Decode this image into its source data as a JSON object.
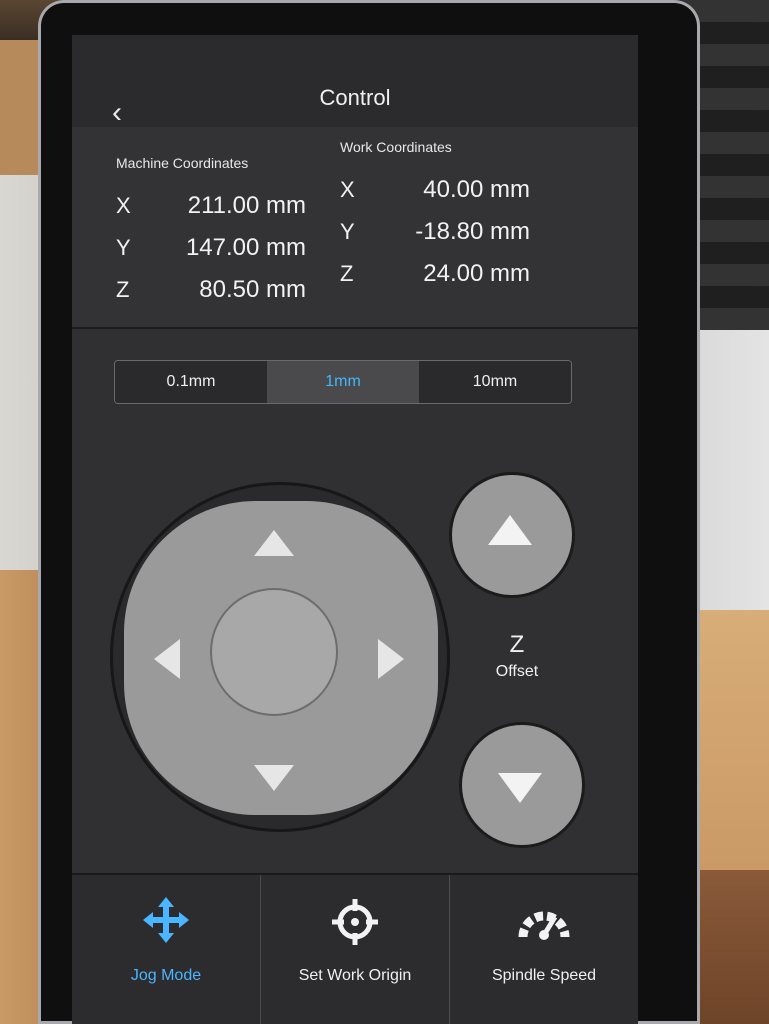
{
  "header": {
    "title": "Control"
  },
  "coordinates": {
    "machine": {
      "heading": "Machine Coordinates",
      "rows": [
        {
          "axis": "X",
          "value": "211.00 mm"
        },
        {
          "axis": "Y",
          "value": "147.00 mm"
        },
        {
          "axis": "Z",
          "value": "80.50 mm"
        }
      ]
    },
    "work": {
      "heading": "Work Coordinates",
      "rows": [
        {
          "axis": "X",
          "value": "40.00 mm"
        },
        {
          "axis": "Y",
          "value": "-18.80 mm"
        },
        {
          "axis": "Z",
          "value": "24.00 mm"
        }
      ]
    }
  },
  "steps": [
    {
      "label": "0.1mm"
    },
    {
      "label": "1mm"
    },
    {
      "label": "10mm"
    }
  ],
  "z_control": {
    "axis": "Z",
    "label": "Offset"
  },
  "tabs": [
    {
      "label": "Jog Mode",
      "icon": "move-arrows-icon"
    },
    {
      "label": "Set Work Origin",
      "icon": "crosshair-icon"
    },
    {
      "label": "Spindle Speed",
      "icon": "gauge-icon"
    }
  ],
  "colors": {
    "accent": "#40b7ff",
    "screen_bg": "#303032"
  }
}
